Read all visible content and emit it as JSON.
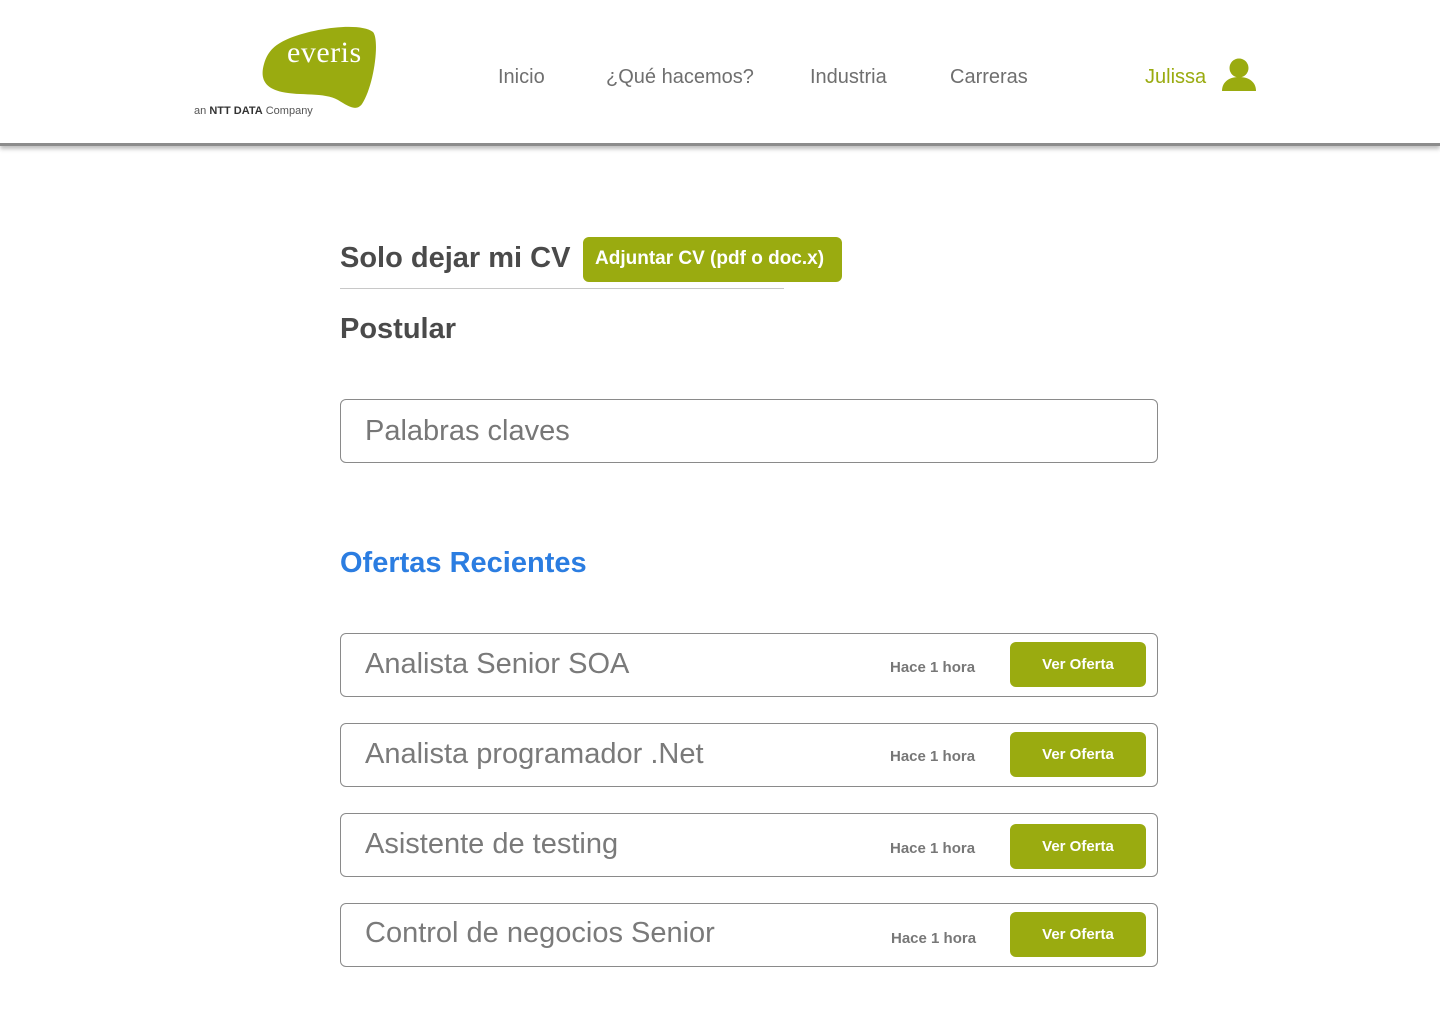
{
  "brand": {
    "name": "everis",
    "tagline_prefix": "an",
    "tagline_strong": "NTT DATA",
    "tagline_suffix": "Company",
    "color": "#9aab10"
  },
  "nav": {
    "items": [
      {
        "label": "Inicio"
      },
      {
        "label": "¿Qué hacemos?"
      },
      {
        "label": "Industria"
      },
      {
        "label": "Carreras"
      }
    ]
  },
  "user": {
    "name": "Julissa",
    "icon": "user-icon"
  },
  "cv": {
    "title": "Solo dejar mi CV",
    "button_label": "Adjuntar CV (pdf o doc.x)"
  },
  "apply": {
    "title": "Postular"
  },
  "search": {
    "placeholder": "Palabras claves",
    "value": ""
  },
  "offers": {
    "title": "Ofertas Recientes",
    "title_color": "#2b7de1",
    "items": [
      {
        "title": "Analista Senior SOA",
        "time": "Hace 1 hora",
        "button_label": "Ver Oferta"
      },
      {
        "title": "Analista programador .Net",
        "time": "Hace 1 hora",
        "button_label": "Ver Oferta"
      },
      {
        "title": "Asistente de testing",
        "time": "Hace 1 hora",
        "button_label": "Ver Oferta"
      },
      {
        "title": "Control de negocios Senior",
        "time": "Hace 1 hora",
        "button_label": "Ver Oferta"
      }
    ]
  }
}
